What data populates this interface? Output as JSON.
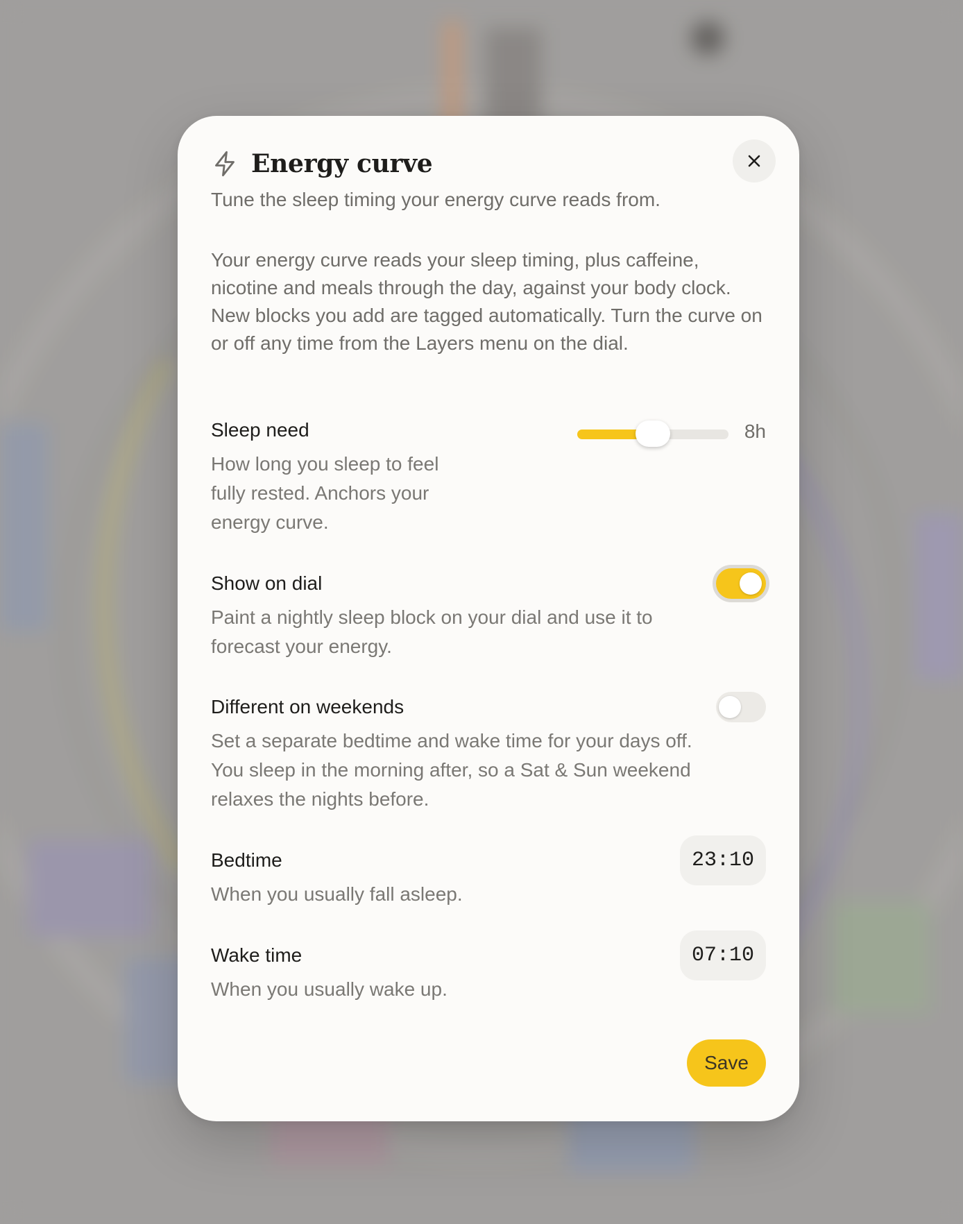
{
  "modal": {
    "title": "Energy curve",
    "subtitle": "Tune the sleep timing your energy curve reads from.",
    "intro": "Your energy curve reads your sleep timing, plus caffeine, nicotine and meals through the day, against your body clock. New blocks you add are tagged automatically. Turn the curve on or off any time from the Layers menu on the dial.",
    "icon": "lightning-bolt-icon",
    "close_icon": "close-icon"
  },
  "sleep_need": {
    "label": "Sleep need",
    "description": "How long you sleep to feel fully rested. Anchors your energy curve.",
    "value": "8h",
    "slider_fraction": 0.5
  },
  "show_on_dial": {
    "label": "Show on dial",
    "description": "Paint a nightly sleep block on your dial and use it to forecast your energy.",
    "enabled": true
  },
  "weekends": {
    "label": "Different on weekends",
    "description": "Set a separate bedtime and wake time for your days off. You sleep in the morning after, so a Sat & Sun weekend relaxes the nights before.",
    "enabled": false
  },
  "bedtime": {
    "label": "Bedtime",
    "description": "When you usually fall asleep.",
    "value": "23:10"
  },
  "wake_time": {
    "label": "Wake time",
    "description": "When you usually wake up.",
    "value": "07:10"
  },
  "actions": {
    "save_label": "Save"
  },
  "colors": {
    "accent": "#f6c51b",
    "modal_bg": "#fcfbf9",
    "text_primary": "#1e1d1b",
    "text_secondary": "#6f6d69"
  }
}
